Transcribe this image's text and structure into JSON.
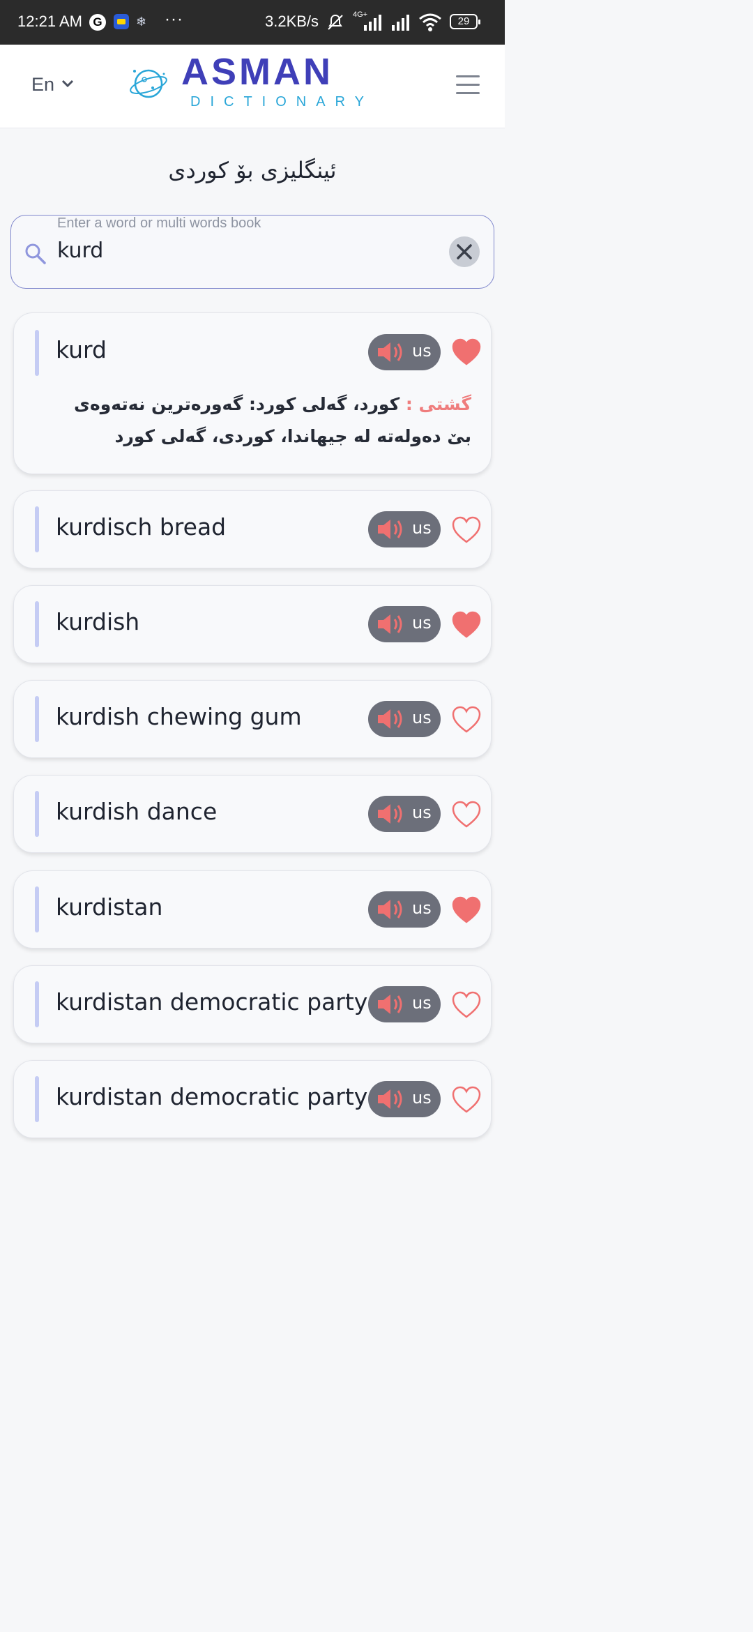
{
  "status_bar": {
    "time": "12:21 AM",
    "g_label": "G",
    "dots": "···",
    "speed": "3.2KB/s",
    "net_badge_top": "4G+",
    "battery": "29"
  },
  "header": {
    "language": "En",
    "logo_word": "ASMAN",
    "logo_sub": "DICTIONARY"
  },
  "page": {
    "title": "ئینگلیزی بۆ کوردی"
  },
  "search": {
    "label": "Enter a word or multi words book",
    "value": "kurd"
  },
  "results": [
    {
      "word": "kurd",
      "accent": "us",
      "favorited": true,
      "definition_tag": "گشتی :",
      "definition": " کورد، گەلی کورد: گەورەترین نەتەوەی بێ دەولەتە لە جیهاندا، کوردی، گەلی کورد"
    },
    {
      "word": "kurdisch bread",
      "accent": "us",
      "favorited": false
    },
    {
      "word": "kurdish",
      "accent": "us",
      "favorited": true
    },
    {
      "word": "kurdish chewing gum",
      "accent": "us",
      "favorited": false
    },
    {
      "word": "kurdish dance",
      "accent": "us",
      "favorited": false
    },
    {
      "word": "kurdistan",
      "accent": "us",
      "favorited": true
    },
    {
      "word": "kurdistan democratic party",
      "accent": "us",
      "favorited": false
    },
    {
      "word": "kurdistan democratic party",
      "accent": "us",
      "favorited": false
    }
  ],
  "colors": {
    "accent": "#3f3fb8",
    "heart": "#f07070",
    "card_bar": "#c5ccf4",
    "audio_bg": "#6c6f7a"
  }
}
